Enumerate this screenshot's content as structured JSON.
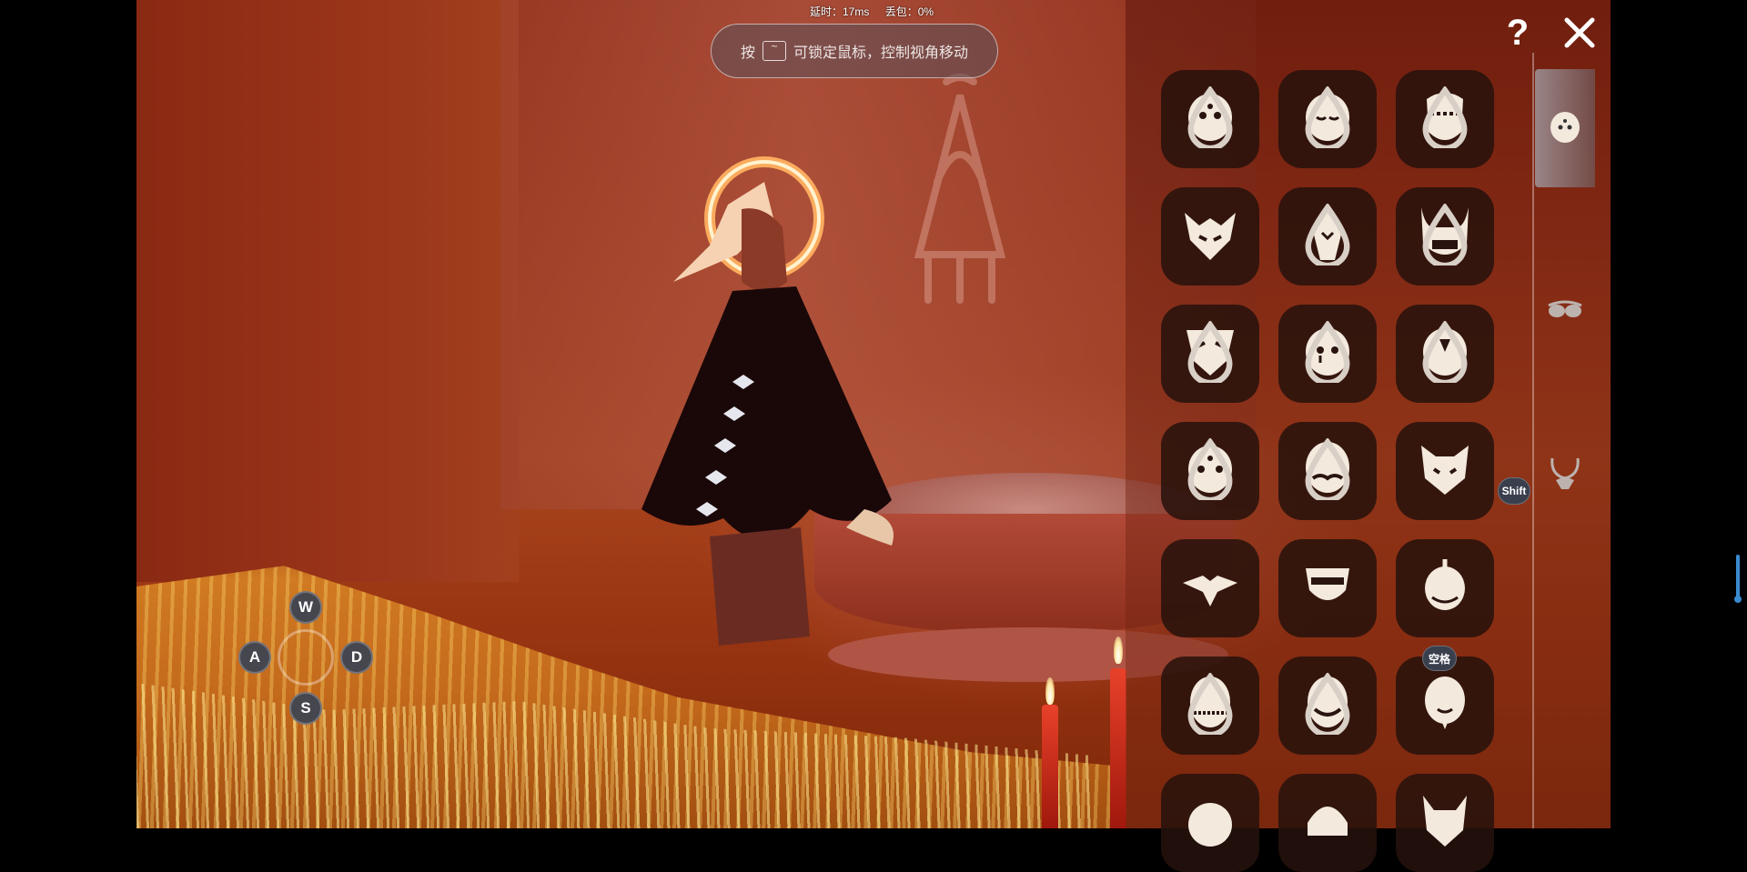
{
  "hud": {
    "latency": "延时：17ms",
    "packet_loss": "丢包：0%",
    "hint_prefix": "按",
    "hint_key": "~",
    "hint_text": "可锁定鼠标，控制视角移动"
  },
  "controls": {
    "w": "W",
    "a": "A",
    "s": "S",
    "d": "D",
    "shift_label": "Shift",
    "space_label": "空格"
  },
  "panel": {
    "help_label": "?",
    "categories": [
      {
        "name": "mask-category",
        "icon": "mask-icon",
        "selected": true
      },
      {
        "name": "glasses-category",
        "icon": "glasses-icon",
        "selected": false
      },
      {
        "name": "necklace-category",
        "icon": "necklace-icon",
        "selected": false
      }
    ],
    "masks": [
      {
        "icon": "dot-eyes-mask-icon",
        "has_drop": true
      },
      {
        "icon": "sleepy-mask-icon",
        "has_drop": true
      },
      {
        "icon": "stitched-mask-icon",
        "has_drop": true
      },
      {
        "icon": "horned-demon-mask-icon",
        "has_drop": false
      },
      {
        "icon": "fox-mask-icon",
        "has_drop": true
      },
      {
        "icon": "ogre-mask-icon",
        "has_drop": true
      },
      {
        "icon": "owl-mask-icon",
        "has_drop": true
      },
      {
        "icon": "tear-mask-icon",
        "has_drop": true
      },
      {
        "icon": "triangle-eye-mask-icon",
        "has_drop": true
      },
      {
        "icon": "three-dot-mask-icon",
        "has_drop": true
      },
      {
        "icon": "mustache-mask-icon",
        "has_drop": true
      },
      {
        "icon": "cat-mask-icon",
        "has_drop": false
      },
      {
        "icon": "bird-mask-icon",
        "has_drop": false
      },
      {
        "icon": "bandit-mask-icon",
        "has_drop": false
      },
      {
        "icon": "bald-face-mask-icon",
        "has_drop": false
      },
      {
        "icon": "fanged-mask-icon",
        "has_drop": true
      },
      {
        "icon": "bearded-mask-icon",
        "has_drop": true
      },
      {
        "icon": "elder-mask-icon",
        "has_drop": false
      },
      {
        "icon": "round-mask-icon",
        "has_drop": false
      },
      {
        "icon": "hat-mask-icon",
        "has_drop": false
      },
      {
        "icon": "antler-mask-icon",
        "has_drop": false
      }
    ]
  }
}
